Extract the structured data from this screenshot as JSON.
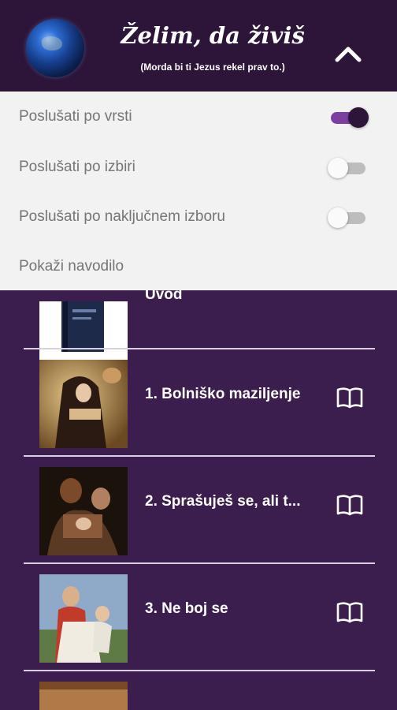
{
  "header": {
    "title": "Želim, da živiš",
    "subtitle": "(Morda bi ti Jezus rekel prav to.)"
  },
  "menu": {
    "items": [
      {
        "label": "Poslušati po vrsti",
        "toggle": true
      },
      {
        "label": "Poslušati po izbiri",
        "toggle": false
      },
      {
        "label": "Poslušati po naključnem izboru",
        "toggle": false
      },
      {
        "label": "Pokaži navodilo"
      }
    ]
  },
  "list": {
    "items": [
      {
        "label": "Uvod"
      },
      {
        "label": "1. Bolniško maziljenje"
      },
      {
        "label": "2. Sprašuješ se, ali t..."
      },
      {
        "label": "3. Ne boj se"
      }
    ]
  },
  "colors": {
    "header_bg": "#2c1538",
    "list_bg": "#3b1e4d",
    "toggle_on": "#7b3fa1"
  },
  "icons": [
    "globe-logo",
    "chevron-up-icon",
    "book-open-icon"
  ]
}
